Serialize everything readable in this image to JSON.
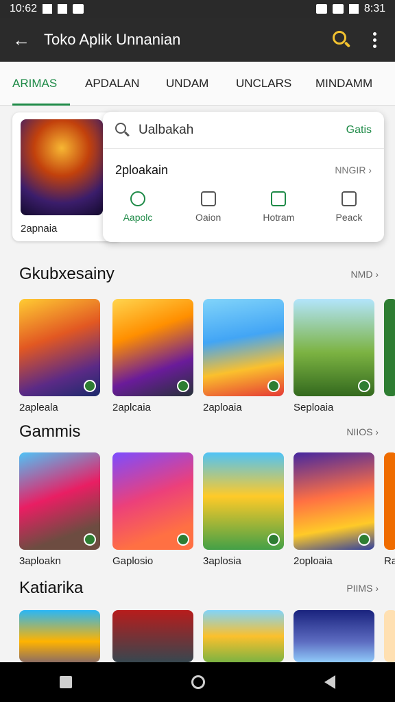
{
  "status": {
    "time": "10:62",
    "clock": "8:31"
  },
  "appbar": {
    "title": "Toko Aplik Unnanian"
  },
  "tabs": [
    {
      "label": "ARIMAS",
      "active": true
    },
    {
      "label": "APDALAN",
      "active": false
    },
    {
      "label": "UNDAM",
      "active": false
    },
    {
      "label": "UNCLARS",
      "active": false
    },
    {
      "label": "MINDAMM",
      "active": false
    }
  ],
  "featured": {
    "label": "2apnaia"
  },
  "popup": {
    "search_value": "Ualbakah",
    "search_link": "Gatis",
    "row_title": "2ploakain",
    "row_more": "NNGIR",
    "actions": [
      {
        "label": "Aapolc",
        "icon": "app-icon"
      },
      {
        "label": "Oaion",
        "icon": "file-icon"
      },
      {
        "label": "Hotram",
        "icon": "bookmark-icon"
      },
      {
        "label": "Peack",
        "icon": "box-icon"
      }
    ]
  },
  "sections": [
    {
      "title": "Gkubxesainy",
      "more": "NMD",
      "items": [
        "2apleala",
        "2aplcaia",
        "2aploaia",
        "Seploaia"
      ]
    },
    {
      "title": "Gammis",
      "more": "NIIOS",
      "items": [
        "3aploakn",
        "Gaplosio",
        "3aplosia",
        "2oploaia",
        "Ra"
      ]
    },
    {
      "title": "Katiarika",
      "more": "PIIMS",
      "items": [
        "",
        "",
        "",
        ""
      ]
    }
  ],
  "colors": {
    "accent": "#1e8a47",
    "appbar": "#2b2b2b",
    "search": "#f2c230"
  }
}
